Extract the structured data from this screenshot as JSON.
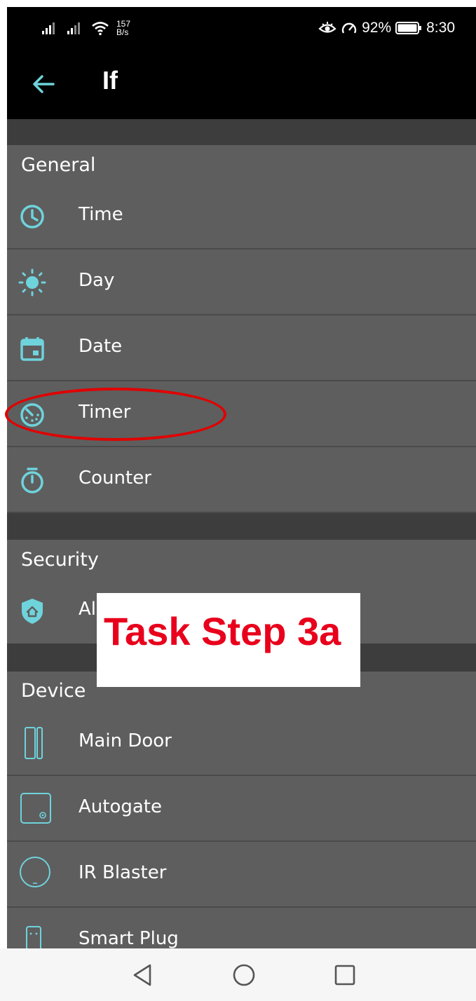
{
  "status_bar": {
    "speed_value": "157",
    "speed_unit": "B/s",
    "battery": "92%",
    "time": "8:30",
    "icons": [
      "signal-icon",
      "signal-icon",
      "wifi-icon",
      "eye-icon",
      "speedometer-icon",
      "battery-icon"
    ]
  },
  "app_bar": {
    "title": "If",
    "back_icon": "arrow-left-icon"
  },
  "sections": {
    "general": {
      "header": "General",
      "items": [
        {
          "label": "Time",
          "icon": "clock-icon"
        },
        {
          "label": "Day",
          "icon": "sun-icon"
        },
        {
          "label": "Date",
          "icon": "calendar-icon"
        },
        {
          "label": "Timer",
          "icon": "timer-icon"
        },
        {
          "label": "Counter",
          "icon": "stopwatch-icon"
        }
      ]
    },
    "security": {
      "header": "Security",
      "items": [
        {
          "label": "Al",
          "icon": "shield-home-icon"
        }
      ]
    },
    "device": {
      "header": "Device",
      "items": [
        {
          "label": "Main Door",
          "icon": "door-sensor-icon"
        },
        {
          "label": "Autogate",
          "icon": "autogate-icon"
        },
        {
          "label": "IR Blaster",
          "icon": "ir-blaster-icon"
        },
        {
          "label": "Smart Plug",
          "icon": "smart-plug-icon"
        }
      ]
    }
  },
  "overlay": {
    "text": "Task Step 3a"
  },
  "nav_bar": {
    "icons": [
      "back-triangle-icon",
      "home-circle-icon",
      "recents-square-icon"
    ]
  },
  "colors": {
    "accent": "#6fd3dc",
    "list_bg": "#5e5e5e",
    "band_bg": "#3d3d3d",
    "annotation_red": "#e10000"
  }
}
